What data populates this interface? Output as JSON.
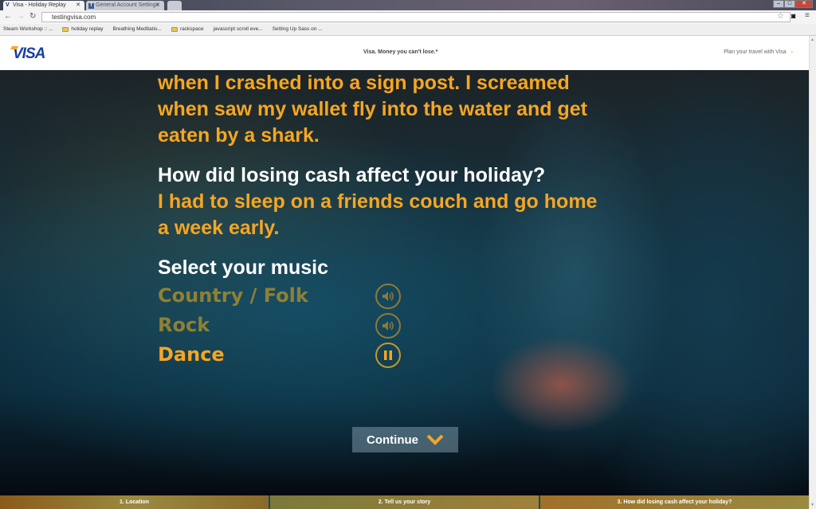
{
  "browser": {
    "tabs": [
      {
        "title": "Visa - Holiday Replay",
        "favicon": "V"
      },
      {
        "title": "General Account Settings",
        "favicon": "f"
      }
    ],
    "url": "testingvisa.com",
    "bookmarks": [
      "Steam Workshop :: ...",
      "holiday replay",
      "Breathing Meditatio...",
      "rackspace",
      "javascript scroll eve...",
      "Setting Up Sass on ..."
    ]
  },
  "header": {
    "logo": "VISA",
    "tagline": "Visa. Money you can't lose.*",
    "plan_link": "Plan your travel with Visa",
    "plan_arrow": "›"
  },
  "story": {
    "lines": [
      "when I crashed into a sign post. I screamed",
      "when saw my wallet fly into the water and get",
      "eaten by a shark."
    ],
    "question": "How did losing cash affect your holiday?",
    "answer_lines": [
      "I had to sleep on a friends couch and go home",
      "a week early."
    ]
  },
  "music": {
    "title": "Select your music",
    "options": [
      {
        "label": "Country / Folk",
        "state": "speaker"
      },
      {
        "label": "Rock",
        "state": "speaker"
      },
      {
        "label": "Dance",
        "state": "pause"
      }
    ]
  },
  "continue_label": "Continue",
  "steps": [
    "1. Location",
    "2. Tell us your story",
    "3. How did losing cash affect your holiday?"
  ],
  "colors": {
    "accent": "#f5a623",
    "visa_blue": "#1a3ea6"
  }
}
